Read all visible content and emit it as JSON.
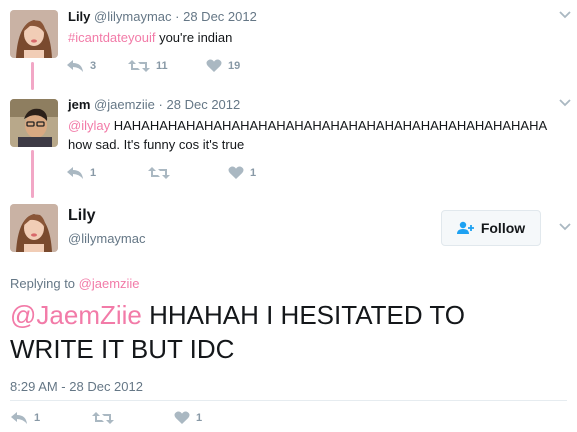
{
  "tweet1": {
    "name": "Lily",
    "handle": "@lilymaymac",
    "dot": "·",
    "date": "28 Dec 2012",
    "hashtag": "#icantdateyouif",
    "text": " you're indian",
    "replies": "3",
    "retweets": "11",
    "likes": "19"
  },
  "tweet2": {
    "name": "jem",
    "handle": "@jaemziie",
    "dot": "·",
    "date": "28 Dec 2012",
    "mention": "@ilylay",
    "text": " HAHAHAHAHAHAHAHAHAHAHAHAHAHAHAHAHAHAHAHAHAHAHAHA how sad. It's funny cos it's true",
    "replies": "1",
    "retweets": "",
    "likes": "1"
  },
  "main": {
    "name": "Lily",
    "handle": "@lilymaymac",
    "follow_label": "Follow",
    "replying_prefix": "Replying to ",
    "replying_to": "@jaemziie",
    "mention": "@JaemZiie",
    "text": " HHAHAH I HESITATED TO WRITE IT BUT IDC",
    "timestamp": "8:29 AM - 28 Dec 2012",
    "replies": "1",
    "retweets": "",
    "likes": "1"
  },
  "colors": {
    "accent": "#f27ba8",
    "thread_line": "#f2a7c6",
    "muted": "#657786",
    "icon": "#8899a6"
  },
  "icons": [
    "reply-icon",
    "retweet-icon",
    "heart-icon",
    "chevron-down-icon",
    "follow-person-icon"
  ]
}
